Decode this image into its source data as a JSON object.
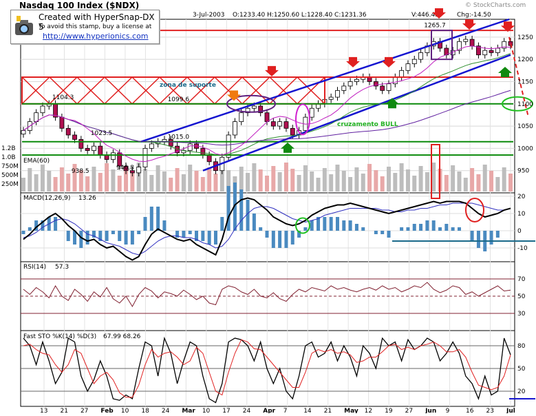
{
  "header": {
    "title": "Nasdaq 100 Index ($NDX)",
    "watermark": "© StockCharts.com",
    "date": "3-Jul-2003",
    "ohlc": "O:1233.40  H:1250.60  L:1228.40  C:1231.36",
    "volume": "V:446.4M",
    "change": "Chg:-14.50"
  },
  "stamp": {
    "line1": "Created with HyperSnap-DX 5",
    "line2": "To avoid this stamp, buy a license at",
    "line3": "http://www.hyperionics.com"
  },
  "chart_data": [
    {
      "type": "candlestick",
      "name": "price",
      "ylim": [
        900,
        1290
      ],
      "price_axis_ticks": [
        1250,
        1200,
        1150,
        1100,
        1050,
        1000,
        950
      ],
      "volume_axis_ticks": [
        "1.2B",
        "1.0B",
        "750M",
        "500M",
        "250M"
      ],
      "ema_label": "EMA(60)",
      "price_labels": [
        "1104.3",
        "1099.6",
        "1023.5",
        "1015.0",
        "938.5",
        "946.8",
        "1265.7"
      ],
      "annotations": [
        "zona de suporte",
        "cruzamento BULL"
      ],
      "close_approx": [
        1040,
        1060,
        1080,
        1095,
        1100,
        1070,
        1045,
        1030,
        1020,
        1000,
        995,
        1005,
        985,
        975,
        990,
        960,
        950,
        945,
        958,
        1000,
        1010,
        1015,
        1020,
        1005,
        990,
        995,
        1010,
        1000,
        985,
        970,
        950,
        980,
        1030,
        1060,
        1080,
        1090,
        1095,
        1080,
        1060,
        1050,
        1060,
        1045,
        1030,
        1040,
        1070,
        1090,
        1100,
        1110,
        1115,
        1130,
        1140,
        1150,
        1155,
        1160,
        1150,
        1140,
        1130,
        1145,
        1160,
        1175,
        1190,
        1200,
        1215,
        1230,
        1240,
        1225,
        1210,
        1220,
        1240,
        1245,
        1230,
        1210,
        1220,
        1215,
        1225,
        1240,
        1231
      ],
      "x_axis_labels": [
        "13",
        "21",
        "27",
        "Feb",
        "10",
        "18",
        "24",
        "Mar",
        "10",
        "17",
        "24",
        "Apr",
        "7",
        "14",
        "21",
        "May",
        "12",
        "19",
        "27",
        "Jun",
        "9",
        "16",
        "23",
        "Jul"
      ]
    },
    {
      "type": "line",
      "name": "macd",
      "label": "MACD(12,26,9)",
      "value": "13.26",
      "ylim": [
        -18,
        22
      ],
      "axis_ticks": [
        20,
        10,
        0,
        -10
      ],
      "macd": [
        -5,
        -2,
        2,
        5,
        8,
        10,
        7,
        3,
        0,
        -4,
        -6,
        -5,
        -8,
        -10,
        -9,
        -12,
        -15,
        -17,
        -15,
        -8,
        -2,
        1,
        -1,
        -3,
        -5,
        -6,
        -5,
        -8,
        -10,
        -12,
        -14,
        -5,
        8,
        15,
        18,
        19,
        18,
        15,
        12,
        8,
        6,
        4,
        3,
        4,
        6,
        9,
        11,
        13,
        14,
        15,
        15,
        16,
        15,
        14,
        13,
        12,
        11,
        10,
        11,
        12,
        13,
        14,
        15,
        16,
        17,
        16,
        17,
        17,
        17,
        16,
        13,
        10,
        8,
        9,
        10,
        12,
        13
      ],
      "signal": [
        -4,
        -3,
        -1,
        2,
        4,
        6,
        7,
        6,
        4,
        1,
        -2,
        -3,
        -5,
        -7,
        -8,
        -9,
        -11,
        -13,
        -14,
        -12,
        -9,
        -6,
        -4,
        -3,
        -3,
        -4,
        -4,
        -5,
        -7,
        -8,
        -10,
        -9,
        -5,
        1,
        6,
        10,
        13,
        14,
        14,
        13,
        11,
        9,
        7,
        6,
        5,
        6,
        7,
        9,
        10,
        11,
        12,
        13,
        13,
        13,
        13,
        13,
        12,
        12,
        11,
        11,
        12,
        12,
        13,
        13,
        14,
        15,
        15,
        16,
        16,
        16,
        16,
        15,
        14,
        13,
        12,
        12,
        13
      ]
    },
    {
      "type": "line",
      "name": "rsi",
      "label": "RSI(14)",
      "value": "57.3",
      "ylim": [
        10,
        90
      ],
      "axis_ticks": [
        70,
        50,
        30
      ],
      "values": [
        58,
        52,
        60,
        55,
        48,
        62,
        50,
        45,
        58,
        52,
        44,
        55,
        49,
        60,
        47,
        42,
        50,
        38,
        52,
        60,
        56,
        48,
        55,
        53,
        50,
        57,
        52,
        46,
        50,
        42,
        40,
        58,
        62,
        60,
        55,
        52,
        58,
        50,
        48,
        54,
        47,
        44,
        52,
        58,
        55,
        60,
        58,
        56,
        62,
        58,
        60,
        57,
        55,
        58,
        60,
        57,
        62,
        58,
        60,
        55,
        58,
        62,
        60,
        66,
        58,
        54,
        57,
        62,
        60,
        52,
        55,
        50,
        54,
        58,
        62,
        56,
        57
      ]
    },
    {
      "type": "line",
      "name": "stoch",
      "label": "Fast STO %K(14) %D(3)",
      "value": "67.99  68.26",
      "ylim": [
        0,
        100
      ],
      "axis_ticks": [
        80,
        50,
        20
      ],
      "k": [
        90,
        80,
        55,
        85,
        60,
        30,
        45,
        90,
        85,
        40,
        20,
        35,
        60,
        40,
        10,
        8,
        15,
        10,
        50,
        85,
        80,
        40,
        90,
        70,
        30,
        60,
        85,
        80,
        40,
        10,
        5,
        30,
        85,
        90,
        88,
        80,
        60,
        85,
        50,
        30,
        50,
        20,
        10,
        40,
        80,
        85,
        65,
        70,
        85,
        60,
        80,
        65,
        40,
        80,
        70,
        50,
        90,
        80,
        85,
        60,
        88,
        75,
        80,
        90,
        85,
        60,
        70,
        85,
        70,
        40,
        30,
        10,
        40,
        15,
        20,
        90,
        68
      ],
      "d": [
        80,
        82,
        75,
        70,
        68,
        55,
        45,
        55,
        75,
        70,
        50,
        30,
        40,
        45,
        35,
        18,
        12,
        12,
        28,
        55,
        75,
        65,
        70,
        72,
        65,
        55,
        60,
        78,
        70,
        45,
        20,
        15,
        45,
        70,
        88,
        85,
        76,
        75,
        65,
        55,
        45,
        35,
        25,
        25,
        45,
        70,
        75,
        72,
        75,
        70,
        72,
        68,
        58,
        60,
        65,
        65,
        72,
        80,
        82,
        75,
        78,
        75,
        80,
        82,
        85,
        80,
        72,
        72,
        75,
        65,
        45,
        28,
        25,
        22,
        25,
        40,
        68
      ]
    }
  ]
}
